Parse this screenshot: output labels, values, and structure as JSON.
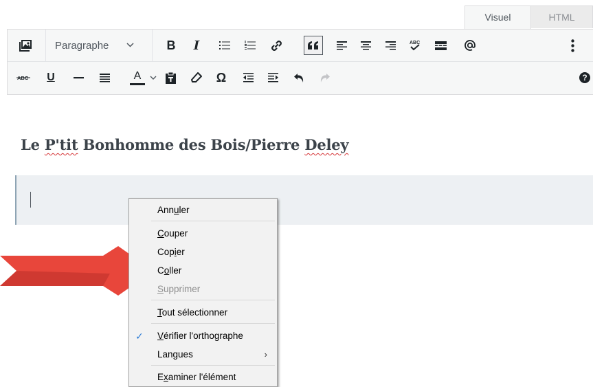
{
  "tabs": {
    "visual": "Visuel",
    "html": "HTML"
  },
  "toolbar": {
    "format_select": "Paragraphe",
    "row1_icons": [
      "add-media-icon",
      "bold-icon",
      "italic-icon",
      "bullet-list-icon",
      "numbered-list-icon",
      "link-icon",
      "blockquote-icon",
      "align-left-icon",
      "align-center-icon",
      "align-right-icon",
      "spellcheck-icon",
      "read-more-icon",
      "mention-icon",
      "more-vertical-icon"
    ],
    "row2_icons": [
      "strikethrough-icon",
      "underline-icon",
      "horizontal-line-icon",
      "justify-icon",
      "text-color-icon",
      "paste-text-icon",
      "clear-formatting-icon",
      "special-character-icon",
      "outdent-icon",
      "indent-icon",
      "undo-icon",
      "redo-icon",
      "help-icon"
    ],
    "bold": "B",
    "italic": "I",
    "underline": "U",
    "text_color": "A",
    "omega": "Ω",
    "help": "?"
  },
  "editor": {
    "title_parts": [
      "Le ",
      "P'tit",
      " Bonhomme des Bois/Pierre ",
      "Deley"
    ]
  },
  "context_menu": {
    "undo": {
      "pre": "Ann",
      "key": "u",
      "post": "ler"
    },
    "cut": {
      "pre": "",
      "key": "C",
      "post": "ouper"
    },
    "copy": {
      "pre": "Cop",
      "key": "i",
      "post": "er"
    },
    "paste": {
      "pre": "C",
      "key": "o",
      "post": "ller"
    },
    "delete": {
      "pre": "",
      "key": "S",
      "post": "upprimer"
    },
    "select_all": {
      "pre": "",
      "key": "T",
      "post": "out sélectionner"
    },
    "spellcheck": {
      "pre": "",
      "key": "V",
      "post": "érifier l'orthographe"
    },
    "languages": {
      "pre": "Lan",
      "key": "g",
      "post": "ues"
    },
    "inspect": {
      "pre": "E",
      "key": "x",
      "post": "aminer l'élément"
    },
    "spellcheck_checked": true,
    "check_glyph": "✓",
    "submenu_glyph": "›"
  },
  "colors": {
    "arrow": "#e8463b",
    "check": "#2a7bd6"
  }
}
